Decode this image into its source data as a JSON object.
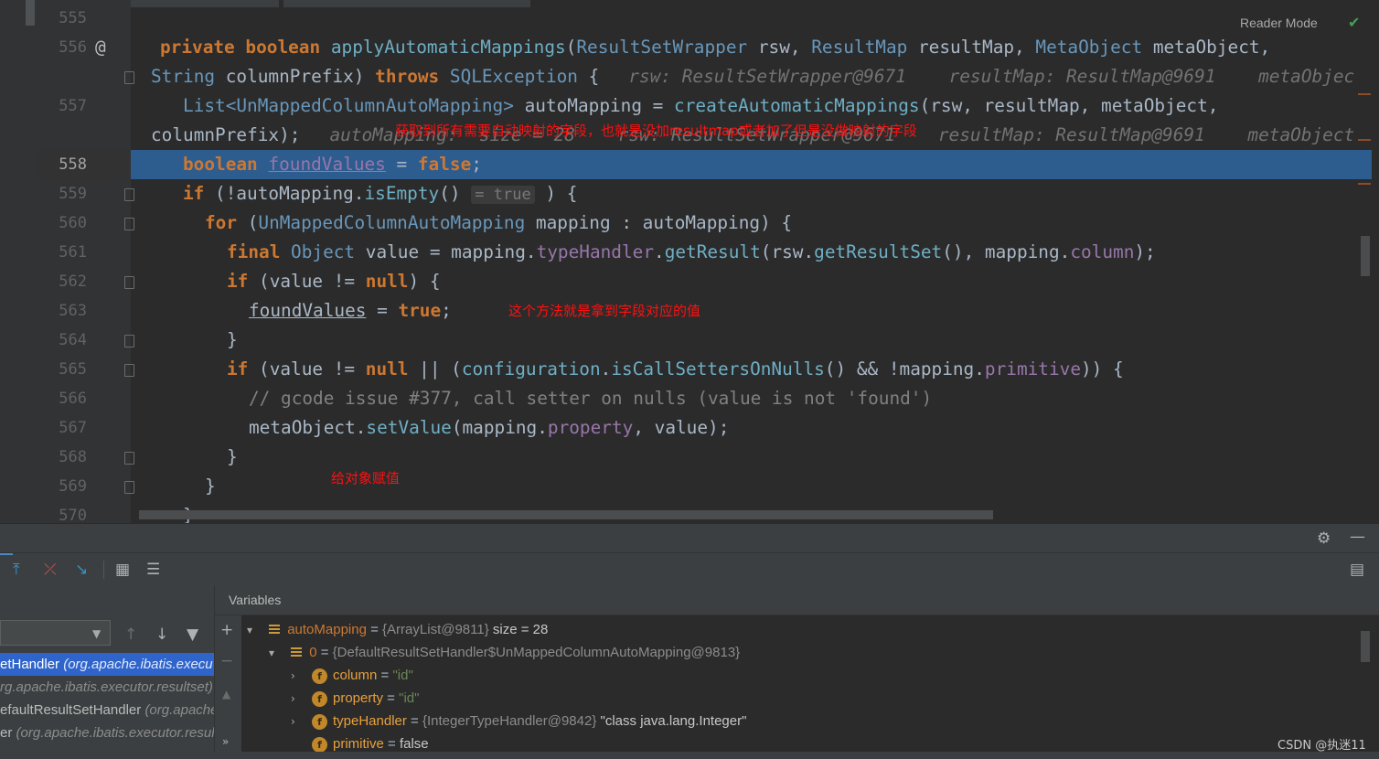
{
  "editor": {
    "reader_mode": "Reader Mode",
    "lines": [
      {
        "no": "555"
      },
      {
        "no": "556"
      },
      {
        "no": "557"
      },
      {
        "no": "558"
      },
      {
        "no": "559"
      },
      {
        "no": "560"
      },
      {
        "no": "561"
      },
      {
        "no": "562"
      },
      {
        "no": "563"
      },
      {
        "no": "564"
      },
      {
        "no": "565"
      },
      {
        "no": "566"
      },
      {
        "no": "567"
      },
      {
        "no": "568"
      },
      {
        "no": "569"
      },
      {
        "no": "570"
      }
    ],
    "code": {
      "l556": {
        "private": "private",
        "boolean": "boolean",
        "method": "applyAutomaticMappings",
        "open": "(",
        "t1": "ResultSetWrapper",
        "p1": " rsw, ",
        "t2": "ResultMap",
        "p2": " resultMap, ",
        "t3": "MetaObject",
        "p3": " metaObject,",
        "at": "@"
      },
      "l556b": {
        "t4": "String",
        "p4": " columnPrefix) ",
        "throws": "throws",
        "ex": " SQLException",
        "brace": " {",
        "hint": "rsw: ResultSetWrapper@9671    resultMap: ResultMap@9691    metaObjec"
      },
      "l557": {
        "t1": "List<",
        "t2": "UnMappedColumnAutoMapping",
        "t3": ">",
        "p1": " autoMapping = ",
        "m": "createAutomaticMappings",
        "p2": "(rsw, resultMap, metaObject,"
      },
      "l557b": {
        "p": "columnPrefix);",
        "hint": "autoMapping:  size = 28    rsw: ResultSetWrapper@9671    resultMap: ResultMap@9691    metaObject"
      },
      "l558": {
        "kw": "boolean",
        "var": "foundValues",
        "eq": " = ",
        "val": "false",
        "end": ";"
      },
      "l559": {
        "kw": "if",
        "p1": " (!autoMapping.",
        "m": "isEmpty",
        "p2": "()",
        "inlay": "= true",
        "p3": " ) {"
      },
      "l560": {
        "kw": "for",
        "p1": " (",
        "t": "UnMappedColumnAutoMapping",
        "p2": " mapping : autoMapping) {"
      },
      "l561": {
        "kw": "final",
        "t": " Object",
        "p1": " value = mapping.",
        "f": "typeHandler",
        "p2": ".",
        "m": "getResult",
        "p3": "(rsw.",
        "m2": "getResultSet",
        "p4": "(), mapping.",
        "f2": "column",
        "p5": ");"
      },
      "l562": {
        "kw": "if",
        "p1": " (value != ",
        "kw2": "null",
        "p2": ") {"
      },
      "l563": {
        "var": "foundValues",
        "eq": " = ",
        "val": "true",
        "end": ";"
      },
      "l564": {
        "p": "}"
      },
      "l565": {
        "kw": "if",
        "p1": " (value != ",
        "kw2": "null",
        "p2": " || (",
        "m": "configuration",
        "p3": ".",
        "m2": "isCallSettersOnNulls",
        "p4": "() && !mapping.",
        "f": "primitive",
        "p5": ")) {"
      },
      "l566": {
        "c": "// gcode issue #377, call setter on nulls (value is not 'found')"
      },
      "l567": {
        "p1": "metaObject.",
        "m": "setValue",
        "p2": "(mapping.",
        "f": "property",
        "p3": ", value);"
      },
      "l568": {
        "p": "}"
      },
      "l569": {
        "p": "}"
      },
      "l570": {
        "p": "}"
      }
    },
    "annotations": {
      "a1": "获取到所有需要自动映射的字段，也就是没加resultmap或者加了但是没做映射的字段",
      "a2": "这个方法就是拿到字段对应的值",
      "a3": "给对象赋值"
    }
  },
  "debugger": {
    "variables_title": "Variables",
    "frames": [
      {
        "name": "etHandler ",
        "pkg": "(org.apache.ibatis.execu"
      },
      {
        "name": "",
        "pkg": "rg.apache.ibatis.executor.resultset)"
      },
      {
        "name": "efaultResultSetHandler ",
        "pkg": "(org.apache"
      },
      {
        "name": "er ",
        "pkg": "(org.apache.ibatis.executor.resul"
      }
    ],
    "variables": [
      {
        "name": "autoMapping",
        "eq": " = ",
        "type": "{ArrayList@9811}",
        "rest": "  size = 28"
      },
      {
        "name": "0",
        "eq": " = ",
        "type": "{DefaultResultSetHandler$UnMappedColumnAutoMapping@9813}",
        "rest": ""
      },
      {
        "name": "column",
        "eq": " = ",
        "val": "\"id\""
      },
      {
        "name": "property",
        "eq": " = ",
        "val": "\"id\""
      },
      {
        "name": "typeHandler",
        "eq": " = ",
        "type": "{IntegerTypeHandler@9842}",
        "val2": " \"class java.lang.Integer\""
      },
      {
        "name": "primitive",
        "eq": " = ",
        "plain": "false"
      }
    ]
  },
  "watermark": "CSDN @执迷11",
  "colors": {
    "highlight_line": "#2d5c8f",
    "keyword": "#cc7832",
    "annotation": "#ff1010",
    "selected_frame": "#2f65ca"
  }
}
